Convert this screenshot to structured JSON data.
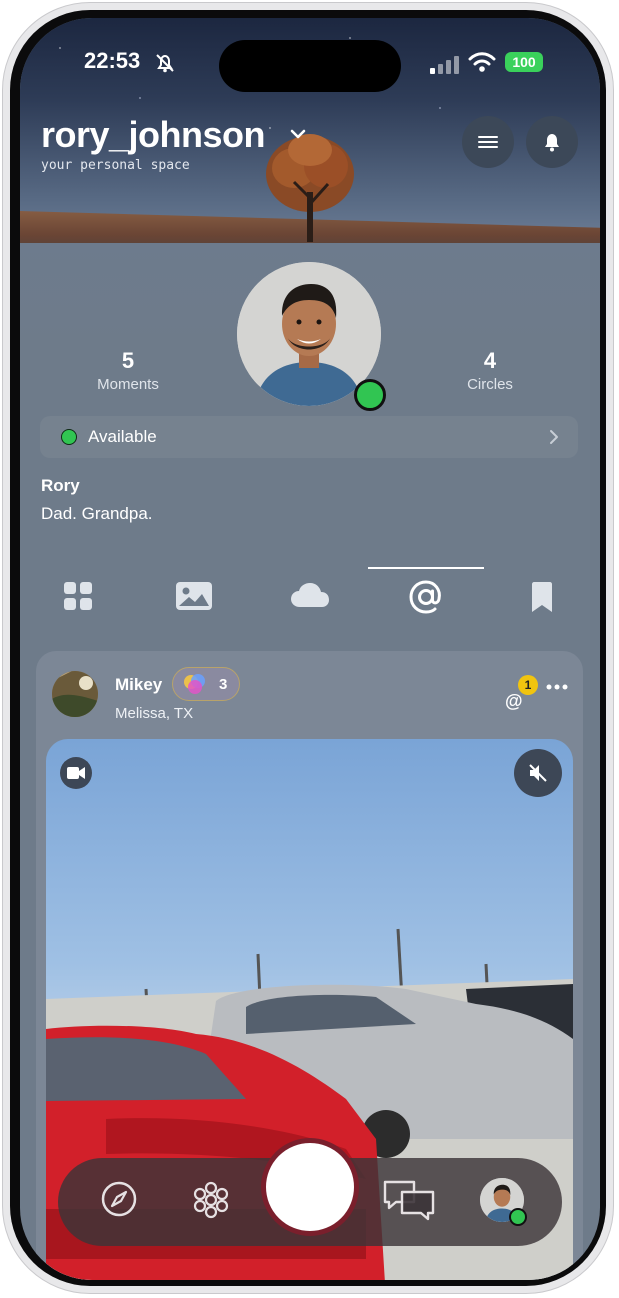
{
  "status_bar": {
    "time": "22:53",
    "battery": "100"
  },
  "header": {
    "username": "rory_johnson",
    "tagline": "your personal space"
  },
  "stats": [
    {
      "value": "5",
      "label": "Moments"
    },
    {
      "value": "4",
      "label": "Circles"
    }
  ],
  "availability": {
    "label": "Available",
    "color": "#31c552"
  },
  "profile": {
    "name": "Rory",
    "bio": "Dad. Grandpa."
  },
  "tabs": [
    "grid",
    "photos",
    "cloud",
    "mentions",
    "saved"
  ],
  "active_tab": "mentions",
  "post": {
    "author": "Mikey",
    "location": "Melissa, TX",
    "circle_count": "3",
    "mention_badge": "1"
  },
  "bottom_nav": [
    "compass-icon",
    "circles-icon",
    "camera-shutter",
    "chat-icon",
    "profile-avatar"
  ],
  "colors": {
    "accent_green": "#31c552",
    "shutter_ring": "#7a1f2c",
    "badge_yellow": "#f1c40f"
  }
}
